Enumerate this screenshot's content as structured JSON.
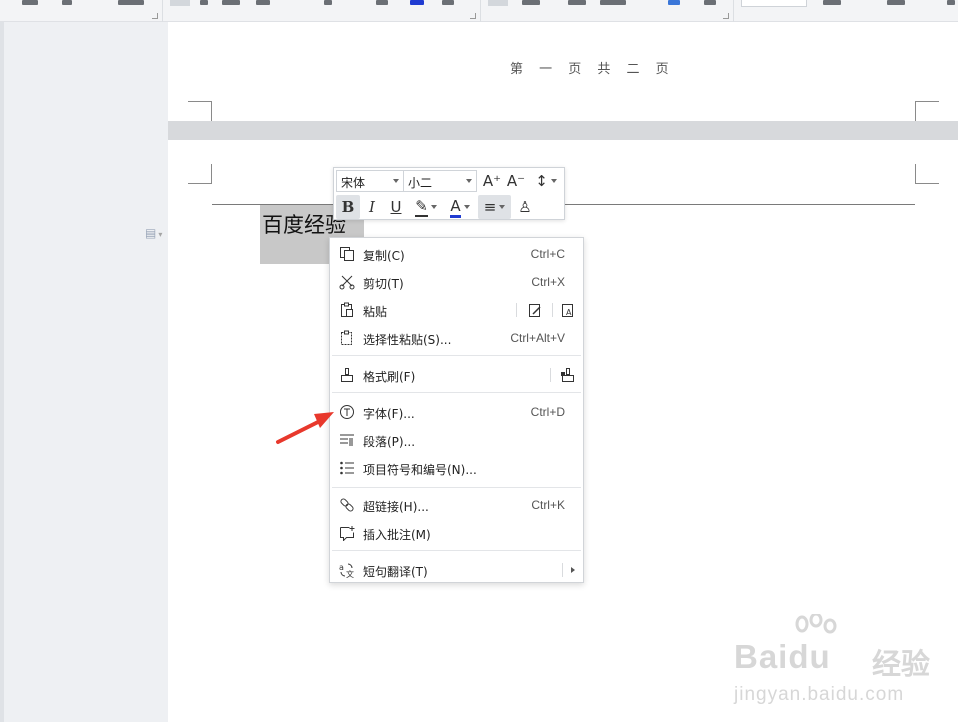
{
  "page": {
    "page_count_label": "第 一 页 共 二 页",
    "selected_text": "百度经验"
  },
  "mini_toolbar": {
    "font_name": "宋体",
    "font_size": "小二",
    "grow_font": "A⁺",
    "shrink_font": "A⁻",
    "line_spacing": "↕",
    "bold": "B",
    "italic": "I",
    "underline": "U",
    "highlight": "✎",
    "font_color": "A",
    "font_color_hex": "#1f3bd1",
    "align": "≡",
    "format_painter": "♙"
  },
  "context_menu": {
    "items": [
      {
        "label": "复制(C)",
        "shortcut": "Ctrl+C",
        "icon": "copy-icon"
      },
      {
        "label": "剪切(T)",
        "shortcut": "Ctrl+X",
        "icon": "scissors-icon"
      },
      {
        "label": "粘贴",
        "shortcut": "",
        "icon": "paste-icon"
      },
      {
        "label": "选择性粘贴(S)...",
        "shortcut": "Ctrl+Alt+V",
        "icon": "paste-special-icon"
      },
      {
        "label": "格式刷(F)",
        "shortcut": "",
        "icon": "format-painter-icon"
      },
      {
        "label": "字体(F)...",
        "shortcut": "Ctrl+D",
        "icon": "font-icon"
      },
      {
        "label": "段落(P)...",
        "shortcut": "",
        "icon": "paragraph-icon"
      },
      {
        "label": "项目符号和编号(N)...",
        "shortcut": "",
        "icon": "bullet-list-icon"
      },
      {
        "label": "超链接(H)...",
        "shortcut": "Ctrl+K",
        "icon": "link-icon"
      },
      {
        "label": "插入批注(M)",
        "shortcut": "",
        "icon": "comment-icon"
      },
      {
        "label": "短句翻译(T)",
        "shortcut": "",
        "icon": "translate-icon"
      }
    ]
  },
  "watermark": {
    "logo": "Baidu",
    "logo_cn": "经验",
    "url": "jingyan.baidu.com"
  },
  "colors": {
    "arrow": "#e8382c",
    "selection": "#c8c8c8"
  }
}
